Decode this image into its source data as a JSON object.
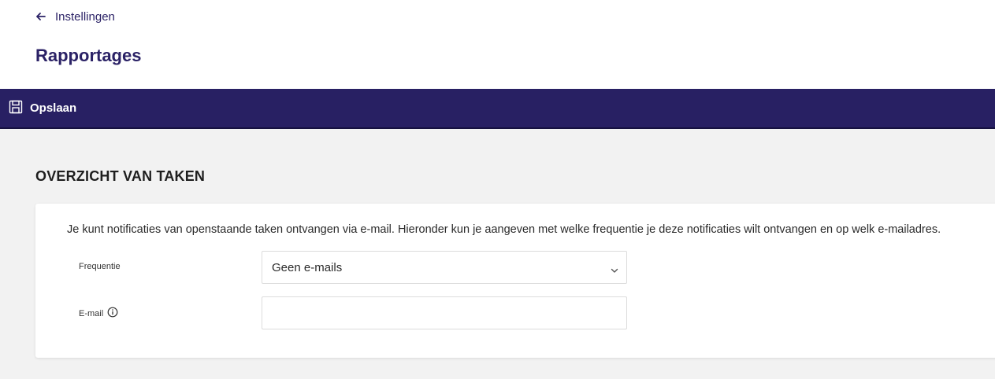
{
  "header": {
    "back_label": "Instellingen",
    "title": "Rapportages"
  },
  "toolbar": {
    "save_label": "Opslaan"
  },
  "section": {
    "heading": "OVERZICHT VAN TAKEN",
    "intro": "Je kunt notificaties van openstaande taken ontvangen via e-mail. Hieronder kun je aangeven met welke frequentie je deze notificaties wilt ontvangen en op welk e-mailadres.",
    "frequency": {
      "label": "Frequentie",
      "selected": "Geen e-mails"
    },
    "email": {
      "label": "E-mail",
      "value": "",
      "placeholder": ""
    }
  },
  "colors": {
    "brand": "#282063",
    "title_text": "#2b2266",
    "content_bg": "#f2f2f2"
  },
  "icons": {
    "back": "arrow-left-icon",
    "save": "floppy-disk-icon",
    "select": "chevron-down-icon",
    "info": "info-circle-icon"
  }
}
